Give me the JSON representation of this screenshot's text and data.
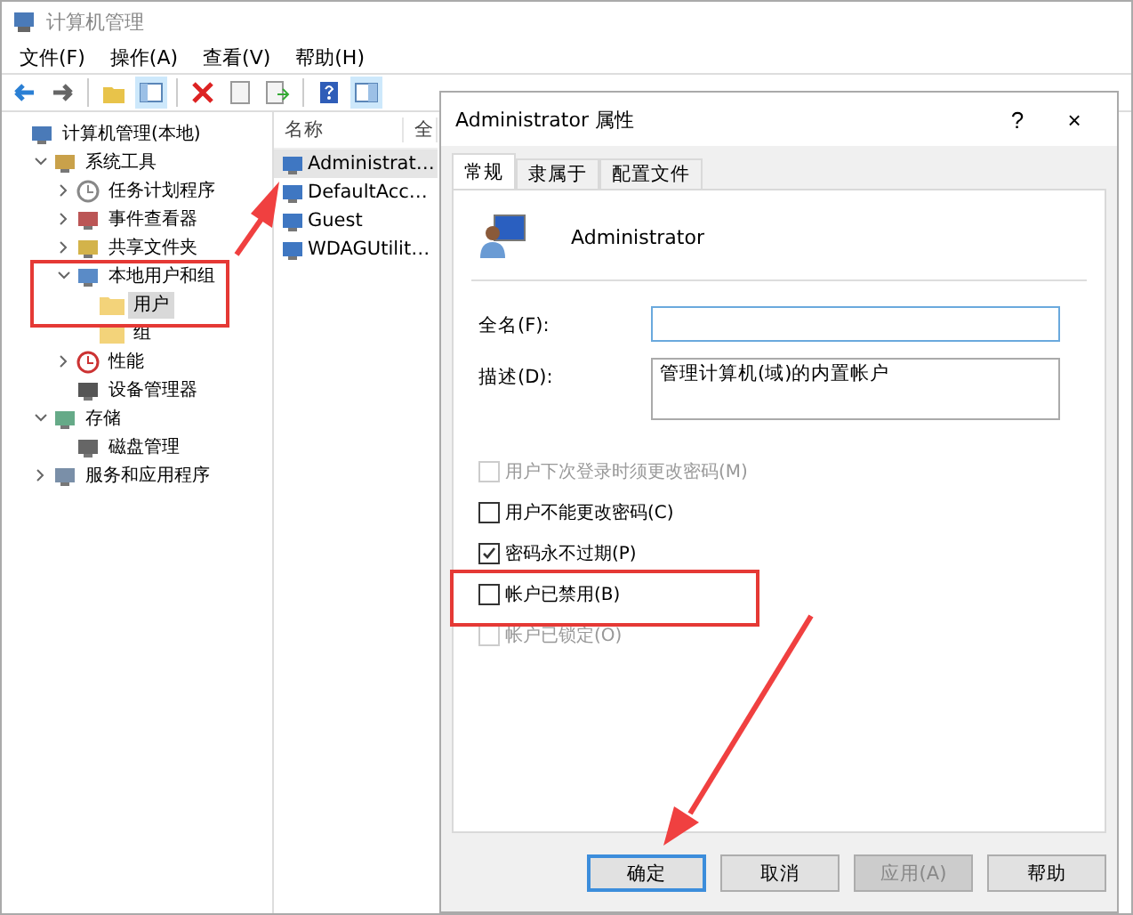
{
  "window": {
    "title": "计算机管理"
  },
  "menu": [
    "文件(F)",
    "操作(A)",
    "查看(V)",
    "帮助(H)"
  ],
  "tree": [
    {
      "label": "计算机管理(本地)",
      "kind": "computer",
      "selected": false,
      "children": [
        {
          "label": "系统工具",
          "kind": "tool",
          "expanded": true,
          "selected": false,
          "children": [
            {
              "label": "任务计划程序",
              "kind": "clock",
              "expanded": false,
              "selected": false
            },
            {
              "label": "事件查看器",
              "kind": "log",
              "expanded": false,
              "selected": false
            },
            {
              "label": "共享文件夹",
              "kind": "share",
              "expanded": false,
              "selected": false
            },
            {
              "label": "本地用户和组",
              "kind": "users",
              "expanded": true,
              "selected": false,
              "children": [
                {
                  "label": "用户",
                  "kind": "folder",
                  "selected": true
                },
                {
                  "label": "组",
                  "kind": "folder",
                  "selected": false
                }
              ]
            },
            {
              "label": "性能",
              "kind": "perf",
              "expanded": false,
              "selected": false
            },
            {
              "label": "设备管理器",
              "kind": "device",
              "selected": false
            }
          ]
        },
        {
          "label": "存储",
          "kind": "storage",
          "expanded": true,
          "selected": false,
          "children": [
            {
              "label": "磁盘管理",
              "kind": "disk",
              "selected": false
            }
          ]
        },
        {
          "label": "服务和应用程序",
          "kind": "service",
          "expanded": false,
          "selected": false
        }
      ]
    }
  ],
  "list": {
    "columns": [
      "名称",
      "全"
    ],
    "rows": [
      {
        "name": "Administrat…",
        "selected": true
      },
      {
        "name": "DefaultAcc…",
        "selected": false
      },
      {
        "name": "Guest",
        "selected": false
      },
      {
        "name": "WDAGUtilit…",
        "selected": false
      }
    ]
  },
  "dialog": {
    "title": "Administrator 属性",
    "help": "?",
    "close": "×",
    "tabs": [
      {
        "label": "常规",
        "selected": true
      },
      {
        "label": "隶属于",
        "selected": false
      },
      {
        "label": "配置文件",
        "selected": false
      }
    ],
    "user": "Administrator",
    "fields": [
      {
        "label": "全名(F):",
        "focused": true
      },
      {
        "label": "描述(D):",
        "value": "管理计算机(域)的内置帐户",
        "focused": false
      }
    ],
    "options": [
      {
        "label": "用户下次登录时须更改密码(M)",
        "checked": false,
        "disabled": true
      },
      {
        "label": "用户不能更改密码(C)",
        "checked": false,
        "disabled": false
      },
      {
        "label": "密码永不过期(P)",
        "checked": true,
        "disabled": false
      },
      {
        "label": "帐户已禁用(B)",
        "checked": false,
        "disabled": false
      },
      {
        "label": "帐户已锁定(O)",
        "checked": false,
        "disabled": true
      }
    ],
    "buttons": [
      {
        "label": "确定",
        "default": true,
        "disabled": false
      },
      {
        "label": "取消",
        "default": false,
        "disabled": false
      },
      {
        "label": "应用(A)",
        "default": false,
        "disabled": true
      },
      {
        "label": "帮助",
        "default": false,
        "disabled": false
      }
    ]
  }
}
